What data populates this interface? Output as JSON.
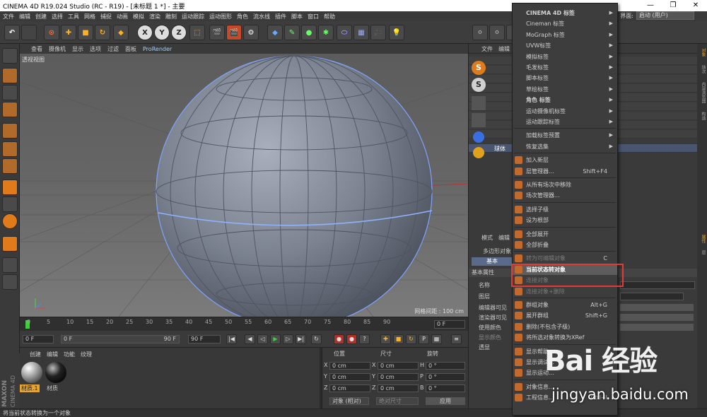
{
  "window": {
    "title": "CINEMA 4D R19.024 Studio (RC - R19) - [未标题 1 *] - 主要",
    "minimize": "—",
    "restore": "❐",
    "close": "✕"
  },
  "menubar": {
    "items": [
      "文件",
      "编辑",
      "创建",
      "选择",
      "工具",
      "网格",
      "捕捉",
      "动画",
      "模拟",
      "渲染",
      "雕刻",
      "运动跟踪",
      "运动图形",
      "角色",
      "流水线",
      "插件",
      "脚本",
      "窗口",
      "帮助"
    ],
    "layout_label": "界面:",
    "layout_value": "启动 (用户)"
  },
  "toolbar": {
    "axis_x": "X",
    "axis_y": "Y",
    "axis_z": "Z"
  },
  "viewport": {
    "menu": [
      "查看",
      "摄像机",
      "显示",
      "选项",
      "过滤",
      "面板"
    ],
    "renderer": "ProRender",
    "label": "透视视图",
    "grid_info": "网格间距 : 100 cm"
  },
  "timeline": {
    "ticks": [
      "0",
      "5",
      "10",
      "15",
      "20",
      "25",
      "30",
      "35",
      "40",
      "45",
      "50",
      "55",
      "60",
      "65",
      "70",
      "75",
      "80",
      "85",
      "90"
    ],
    "current_frame": "0 F"
  },
  "playbar": {
    "start": "0 F",
    "current": "0 F",
    "end_slider": "90 F",
    "end": "90 F"
  },
  "materials": {
    "tabs": [
      "创建",
      "编辑",
      "功能",
      "纹理"
    ],
    "items": [
      {
        "label": "材质.1",
        "color": "#e6a532"
      },
      {
        "label": "材质",
        "color": "#444444"
      }
    ]
  },
  "maxon": {
    "line1": "MAXON",
    "line2": "CINEMA 4D"
  },
  "coords": {
    "headers": [
      "位置",
      "尺寸",
      "旋转"
    ],
    "rows": [
      {
        "axis": "X",
        "pos": "0 cm",
        "axis2": "X",
        "size": "0 cm",
        "rot_axis": "H",
        "rot": "0 °"
      },
      {
        "axis": "Y",
        "pos": "0 cm",
        "axis2": "Y",
        "size": "0 cm",
        "rot_axis": "P",
        "rot": "0 °"
      },
      {
        "axis": "Z",
        "pos": "0 cm",
        "axis2": "Z",
        "size": "0 cm",
        "rot_axis": "B",
        "rot": "0 °"
      }
    ],
    "mode": "对象 (相对)",
    "size_mode": "绝对尺寸",
    "apply": "应用"
  },
  "object_manager": {
    "menu": [
      "文件",
      "编辑"
    ],
    "row_label": "球体"
  },
  "attributes": {
    "menu": [
      "模式",
      "编辑"
    ],
    "object_label": "多边形对象 [",
    "tab": "基本",
    "section": "基本属性",
    "fields": [
      "名称",
      "图层",
      "编辑器可见",
      "渲染器可见",
      "使用颜色",
      "显示颜色",
      "透显"
    ]
  },
  "right_tabs": [
    "对象",
    "场次",
    "内容浏览器",
    "构造",
    "属性",
    "层"
  ],
  "context_menu": {
    "items": [
      {
        "label": "CINEMA 4D 标签",
        "arrow": true,
        "bold": true
      },
      {
        "label": "Cineman 标签",
        "arrow": true
      },
      {
        "label": "MoGraph 标签",
        "arrow": true
      },
      {
        "label": "UVW标签",
        "arrow": true
      },
      {
        "label": "模拟标签",
        "arrow": true
      },
      {
        "label": "毛发标签",
        "arrow": true
      },
      {
        "label": "脚本标签",
        "arrow": true
      },
      {
        "label": "草绘标签",
        "arrow": true
      },
      {
        "label": "角色 标签",
        "arrow": true,
        "bold": true
      },
      {
        "label": "运动摄像机标签",
        "arrow": true
      },
      {
        "label": "运动跟踪标签",
        "arrow": true
      },
      {
        "label": "加载标签预置",
        "arrow": true,
        "sep_before": true
      },
      {
        "label": "恢复选集",
        "arrow": true
      },
      {
        "label": "加入新层",
        "icon": true,
        "sep_before": true
      },
      {
        "label": "层管理器...",
        "icon": true,
        "shortcut": "Shift+F4"
      },
      {
        "label": "从所有场次中移除",
        "icon": true,
        "sep_before": true
      },
      {
        "label": "场次管理器...",
        "icon": true
      },
      {
        "label": "选择子级",
        "icon": true,
        "sep_before": true
      },
      {
        "label": "设为根部",
        "icon": true
      },
      {
        "label": "全部展开",
        "icon": true,
        "sep_before": true
      },
      {
        "label": "全部折叠",
        "icon": true
      },
      {
        "label": "转为可编辑对象",
        "icon": true,
        "shortcut": "C",
        "disabled": true,
        "sep_before": true
      },
      {
        "label": "当前状态转对象",
        "icon": true,
        "highlight": true
      },
      {
        "label": "连接对象",
        "icon": true,
        "disabled": true
      },
      {
        "label": "连接对象+删除",
        "icon": true,
        "disabled": true
      },
      {
        "label": "群组对象",
        "icon": true,
        "shortcut": "Alt+G",
        "sep_before": true
      },
      {
        "label": "展开群组",
        "icon": true,
        "shortcut": "Shift+G"
      },
      {
        "label": "删除(不包含子级)",
        "icon": true
      },
      {
        "label": "将所选对象转换为XRef",
        "icon": true
      },
      {
        "label": "显示帮助...",
        "icon": true,
        "sep_before": true
      },
      {
        "label": "显示调试...",
        "icon": true
      },
      {
        "label": "显示运动...",
        "icon": true
      },
      {
        "label": "对象信息...",
        "icon": true,
        "sep_before": true
      },
      {
        "label": "工程信息...",
        "icon": true,
        "shortcut": "Ctrl+I"
      }
    ]
  },
  "status_bar": "将当前状态转换为一个对象",
  "watermark": {
    "brand": "Bai 经验",
    "url": "jingyan.baidu.com"
  }
}
